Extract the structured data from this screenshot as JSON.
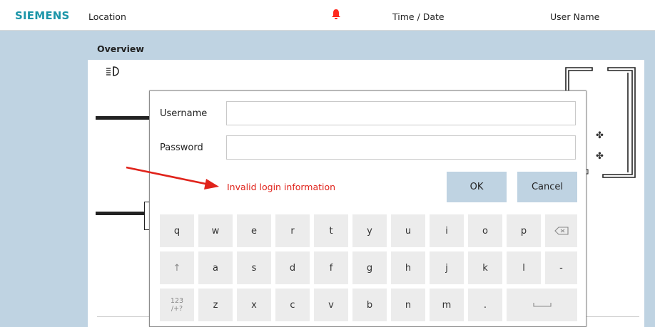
{
  "header": {
    "brand": "SIEMENS",
    "location": "Location",
    "time_date": "Time / Date",
    "user_name": "User Name",
    "alarm_icon": "bell-icon",
    "alarm_color": "#ff2a1f"
  },
  "main": {
    "title": "Overview"
  },
  "dialog": {
    "username_label": "Username",
    "password_label": "Password",
    "username_value": "",
    "password_value": "",
    "error_text": "Invalid login information",
    "ok_label": "OK",
    "cancel_label": "Cancel"
  },
  "keyboard": {
    "row1": [
      "q",
      "w",
      "e",
      "r",
      "t",
      "y",
      "u",
      "i",
      "o",
      "p"
    ],
    "backspace": "⌫",
    "row2_shift": "↑",
    "row2": [
      "a",
      "s",
      "d",
      "f",
      "g",
      "h",
      "j",
      "k",
      "l",
      "-"
    ],
    "row3_mode_a": "123",
    "row3_mode_b": "/+?",
    "row3": [
      "z",
      "x",
      "c",
      "v",
      "b",
      "n",
      "m",
      "."
    ],
    "space": "⎵"
  },
  "colors": {
    "brand": "#1b95a8",
    "accent_blue": "#bfd3e2",
    "error_red": "#e0231b"
  }
}
